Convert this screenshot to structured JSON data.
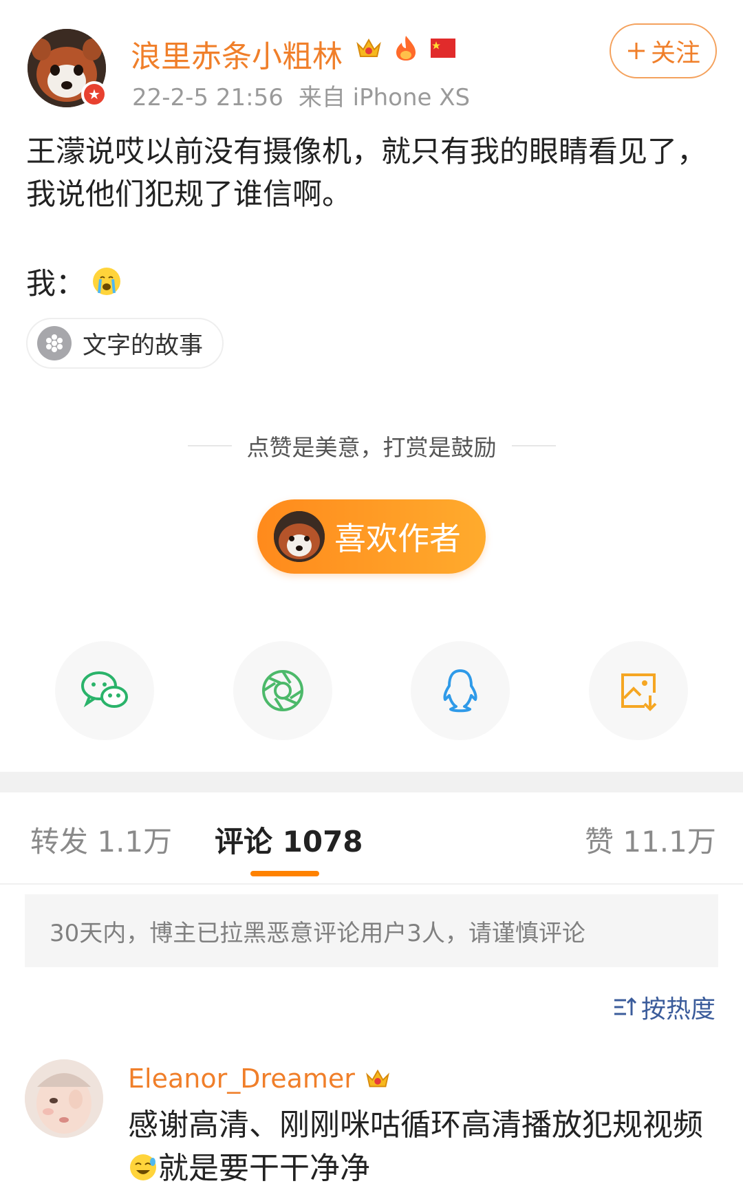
{
  "post": {
    "author": "浪里赤条小粗林",
    "timestamp": "22-2-5 21:56",
    "source": "来自 iPhone XS",
    "follow_label": "关注",
    "follow_icon": "plus-icon",
    "text": "王濛说哎以前没有摄像机，就只有我的眼睛看见了，我说他们犯规了谁信啊。",
    "me_label": "我：",
    "me_emoji": "crying-face-emoji",
    "topic": "文字的故事",
    "badges": [
      "crown-badge-icon",
      "fire-badge-icon",
      "china-flag-icon"
    ]
  },
  "reward": {
    "slogan": "点赞是美意，打赏是鼓励",
    "like_author_label": "喜欢作者"
  },
  "share": [
    "wechat-icon",
    "moments-icon",
    "qq-icon",
    "save-image-icon"
  ],
  "tabs": {
    "repost": "转发 1.1万",
    "comments": "评论 1078",
    "likes": "赞 11.1万"
  },
  "notice": "30天内，博主已拉黑恶意评论用户3人，请谨慎评论",
  "sort_label": "按热度",
  "comment": {
    "user": "Eleanor_Dreamer",
    "text_part1": "感谢高清、刚刚咪咕循环高清播放犯规视频",
    "text_part2": "就是要干干净净"
  },
  "colors": {
    "accent": "#f07f2a",
    "orange_button": "#ff8a1c",
    "link_blue": "#3b5c9b",
    "wechat_green": "#2ab36a",
    "qq_blue": "#2f9ae8",
    "save_orange": "#f5a623"
  }
}
